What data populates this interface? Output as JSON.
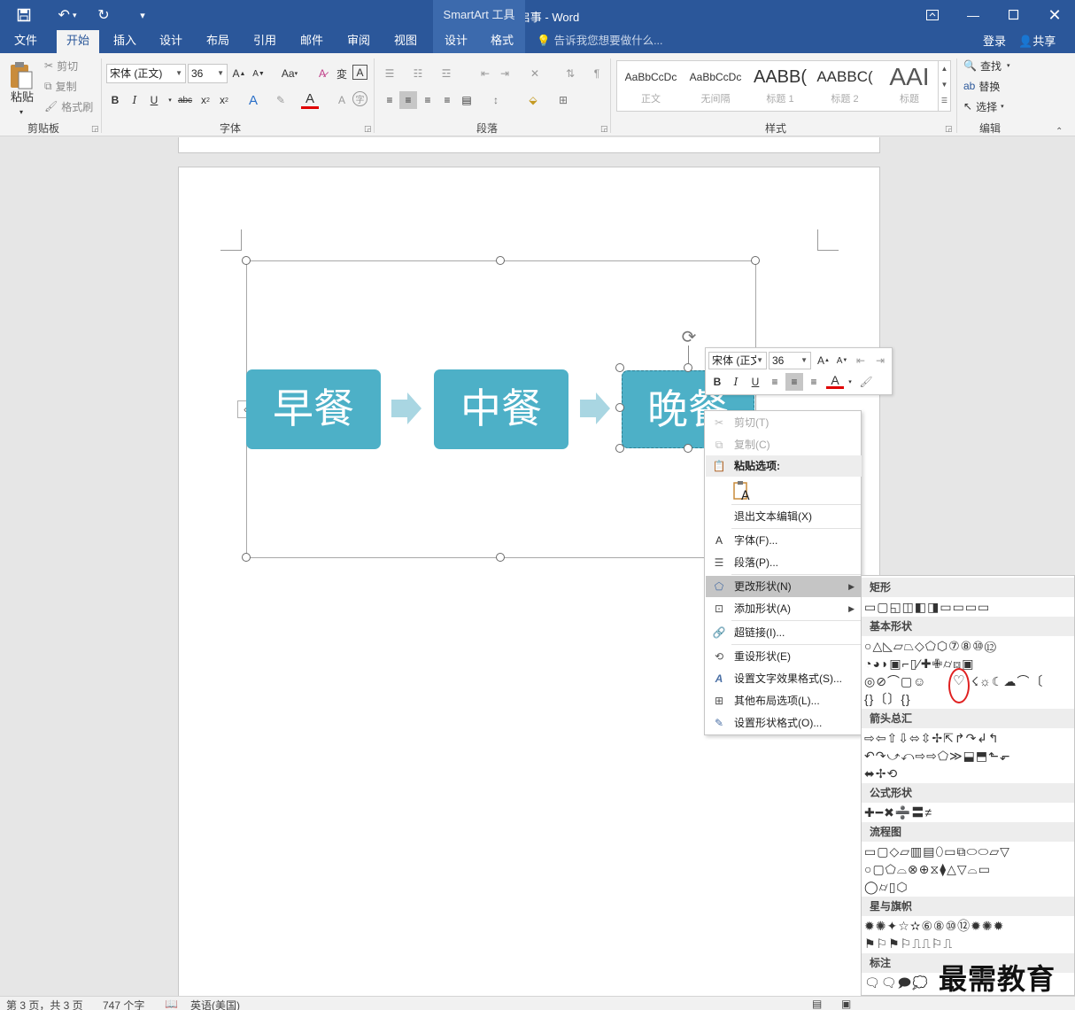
{
  "window": {
    "title": "招聘启事 - Word",
    "context_tab_header": "SmartArt 工具"
  },
  "tabs": [
    "文件",
    "开始",
    "插入",
    "设计",
    "布局",
    "引用",
    "邮件",
    "审阅",
    "视图",
    "设计",
    "格式"
  ],
  "active_tab": "开始",
  "tell_me": "告诉我您想要做什么...",
  "account": {
    "login": "登录",
    "share": "共享"
  },
  "ribbon": {
    "clipboard": {
      "paste": "粘贴",
      "cut": "剪切",
      "copy": "复制",
      "format_painter": "格式刷",
      "label": "剪贴板"
    },
    "font": {
      "name": "宋体 (正文)",
      "size": "36",
      "case_btn": "Aa",
      "label": "字体"
    },
    "paragraph": {
      "label": "段落"
    },
    "styles": {
      "items": [
        {
          "sample": "AaBbCcDc",
          "name": "正文"
        },
        {
          "sample": "AaBbCcDc",
          "name": "无间隔"
        },
        {
          "sample": "AABB(",
          "name": "标题 1"
        },
        {
          "sample": "AABBC(",
          "name": "标题 2"
        },
        {
          "sample": "AAI",
          "name": "标题"
        }
      ],
      "label": "样式"
    },
    "editing": {
      "find": "查找",
      "replace": "替换",
      "select": "选择",
      "label": "编辑"
    }
  },
  "smartart": {
    "nodes": [
      "早餐",
      "中餐",
      "晚餐"
    ],
    "node_color": "#4db0c7",
    "arrow_color": "#a9d6e2"
  },
  "mini_toolbar": {
    "font": "宋体 (正文",
    "size": "36"
  },
  "context_menu": {
    "items": [
      {
        "label": "剪切(T)",
        "icon": "scissors-icon",
        "disabled": true
      },
      {
        "label": "复制(C)",
        "icon": "copy-icon",
        "disabled": true
      },
      {
        "label": "粘贴选项:",
        "icon": "paste-icon",
        "header": true
      },
      {
        "label": "退出文本编辑(X)"
      },
      {
        "label": "字体(F)...",
        "icon": "font-icon"
      },
      {
        "label": "段落(P)...",
        "icon": "paragraph-icon"
      },
      {
        "label": "更改形状(N)",
        "icon": "change-shape-icon",
        "submenu": true,
        "highlighted": true
      },
      {
        "label": "添加形状(A)",
        "icon": "add-shape-icon",
        "submenu": true
      },
      {
        "label": "超链接(I)...",
        "icon": "hyperlink-icon"
      },
      {
        "label": "重设形状(E)",
        "icon": "reset-shape-icon"
      },
      {
        "label": "设置文字效果格式(S)...",
        "icon": "text-effects-icon"
      },
      {
        "label": "其他布局选项(L)...",
        "icon": "layout-icon"
      },
      {
        "label": "设置形状格式(O)...",
        "icon": "format-shape-icon"
      }
    ]
  },
  "shape_gallery": {
    "categories": [
      "矩形",
      "基本形状",
      "箭头总汇",
      "公式形状",
      "流程图",
      "星与旗帜",
      "标注"
    ],
    "highlight_color": "#e02020"
  },
  "status_bar": {
    "page": "第 3 页，共 3 页",
    "words": "747 个字",
    "language": "英语(美国)"
  },
  "watermark": "最需教育"
}
